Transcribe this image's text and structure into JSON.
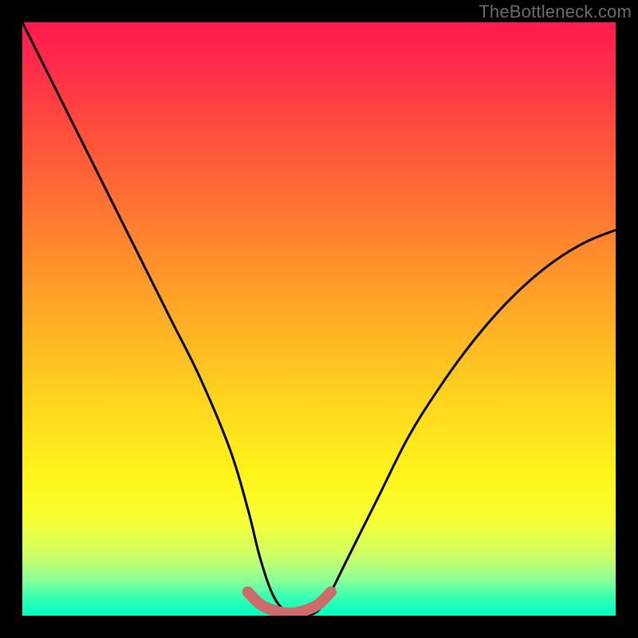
{
  "watermark": "TheBottleneck.com",
  "chart_data": {
    "type": "line",
    "title": "",
    "xlabel": "",
    "ylabel": "",
    "xlim": [
      0,
      100
    ],
    "ylim": [
      0,
      100
    ],
    "series": [
      {
        "name": "bottleneck-curve",
        "x": [
          0,
          5,
          10,
          15,
          20,
          25,
          30,
          35,
          38,
          40,
          42,
          44,
          46,
          48,
          50,
          52,
          55,
          60,
          65,
          70,
          75,
          80,
          85,
          90,
          95,
          100
        ],
        "y": [
          100,
          90,
          80,
          70,
          60,
          50,
          40,
          28,
          18,
          10,
          4,
          1,
          0,
          0,
          1,
          4,
          10,
          20,
          30,
          38,
          45,
          51,
          56,
          60,
          63,
          65
        ]
      },
      {
        "name": "optimal-band",
        "x": [
          38,
          40,
          42,
          44,
          46,
          48,
          50,
          52
        ],
        "y": [
          4,
          2,
          1,
          0.5,
          0.5,
          1,
          2,
          4
        ]
      }
    ],
    "colors": {
      "curve": "#000000",
      "optimal_band": "#cf6a6a",
      "gradient_top": "#ff1a4d",
      "gradient_bottom": "#00ffc0"
    }
  }
}
